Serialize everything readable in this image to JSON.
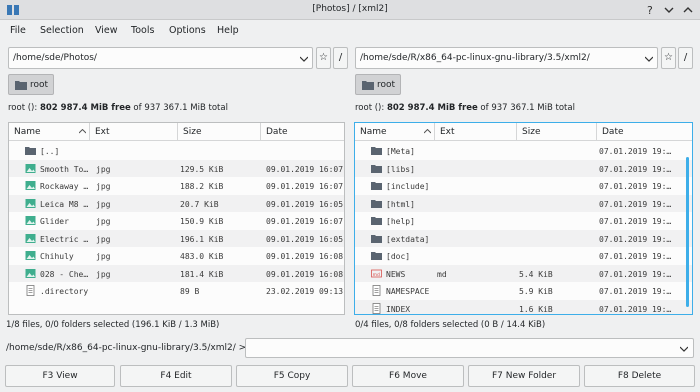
{
  "window": {
    "title": "[Photos] / [xml2]"
  },
  "menu": [
    "File",
    "Selection",
    "View",
    "Tools",
    "Options",
    "Help"
  ],
  "left": {
    "path": "/home/sde/Photos/",
    "root_label": "root",
    "free": "root (): ",
    "free_bold": "802 987.4 MiB free",
    "free_rest": " of 937 367.1 MiB total",
    "columns": [
      "Name",
      "Ext",
      "Size",
      "Date"
    ],
    "rows": [
      {
        "name": "[..]",
        "ext": "",
        "size": "",
        "date": "",
        "icon": "folder-icon"
      },
      {
        "name": "Smooth To…",
        "ext": "jpg",
        "size": "129.5 KiB",
        "date": "09.01.2019 16:07",
        "icon": "image-icon"
      },
      {
        "name": "Rockaway …",
        "ext": "jpg",
        "size": "188.2 KiB",
        "date": "09.01.2019 16:07",
        "icon": "image-icon"
      },
      {
        "name": "Leica M8 …",
        "ext": "jpg",
        "size": "20.7 KiB",
        "date": "09.01.2019 16:05",
        "icon": "image-icon"
      },
      {
        "name": "Glider",
        "ext": "jpg",
        "size": "150.9 KiB",
        "date": "09.01.2019 16:07",
        "icon": "image-icon"
      },
      {
        "name": "Electric …",
        "ext": "jpg",
        "size": "196.1 KiB",
        "date": "09.01.2019 16:05",
        "icon": "image-icon"
      },
      {
        "name": "Chihuly",
        "ext": "jpg",
        "size": "483.0 KiB",
        "date": "09.01.2019 16:08",
        "icon": "image-icon"
      },
      {
        "name": "028 - Che…",
        "ext": "jpg",
        "size": "181.4 KiB",
        "date": "09.01.2019 16:08",
        "icon": "image-icon"
      },
      {
        "name": ".directory",
        "ext": "",
        "size": "89 B",
        "date": "23.02.2019 09:13",
        "icon": "text-file-icon"
      }
    ],
    "status": "1/8 files, 0/0 folders selected (196.1 KiB / 1.3 MiB)"
  },
  "right": {
    "path": "/home/sde/R/x86_64-pc-linux-gnu-library/3.5/xml2/",
    "root_label": "root",
    "free": "root (): ",
    "free_bold": "802 987.4 MiB free",
    "free_rest": " of 937 367.1 MiB total",
    "columns": [
      "Name",
      "Ext",
      "Size",
      "Date"
    ],
    "rows": [
      {
        "name": "[Meta]",
        "ext": "",
        "size": "",
        "date": "07.01.2019 19:…",
        "icon": "folder-icon"
      },
      {
        "name": "[libs]",
        "ext": "",
        "size": "",
        "date": "07.01.2019 19:…",
        "icon": "folder-icon"
      },
      {
        "name": "[include]",
        "ext": "",
        "size": "",
        "date": "07.01.2019 19:…",
        "icon": "folder-icon"
      },
      {
        "name": "[html]",
        "ext": "",
        "size": "",
        "date": "07.01.2019 19:…",
        "icon": "folder-icon"
      },
      {
        "name": "[help]",
        "ext": "",
        "size": "",
        "date": "07.01.2019 19:…",
        "icon": "folder-icon"
      },
      {
        "name": "[extdata]",
        "ext": "",
        "size": "",
        "date": "07.01.2019 19:…",
        "icon": "folder-icon"
      },
      {
        "name": "[doc]",
        "ext": "",
        "size": "",
        "date": "07.01.2019 19:…",
        "icon": "folder-icon"
      },
      {
        "name": "NEWS",
        "ext": "md",
        "size": "5.4 KiB",
        "date": "07.01.2019 19:…",
        "icon": "markdown-file-icon"
      },
      {
        "name": "NAMESPACE",
        "ext": "",
        "size": "5.9 KiB",
        "date": "07.01.2019 19:…",
        "icon": "text-file-icon"
      },
      {
        "name": "INDEX",
        "ext": "",
        "size": "1.6 KiB",
        "date": "07.01.2019 19:…",
        "icon": "text-file-icon"
      }
    ],
    "status": "0/4 files, 0/8 folders selected (0 B / 14.4 KiB)"
  },
  "path_buttons": {
    "favorite": "☆",
    "root": "/"
  },
  "command": {
    "label": "/home/sde/R/x86_64-pc-linux-gnu-library/3.5/xml2/  >",
    "value": ""
  },
  "fkeys": [
    "F3 View",
    "F4 Edit",
    "F5 Copy",
    "F6 Move",
    "F7 New Folder",
    "F8 Delete"
  ],
  "colors": {
    "accent": "#3daee9",
    "folder": "#5a6470",
    "image": "#3fae8e",
    "markdown": "#d9534f"
  }
}
